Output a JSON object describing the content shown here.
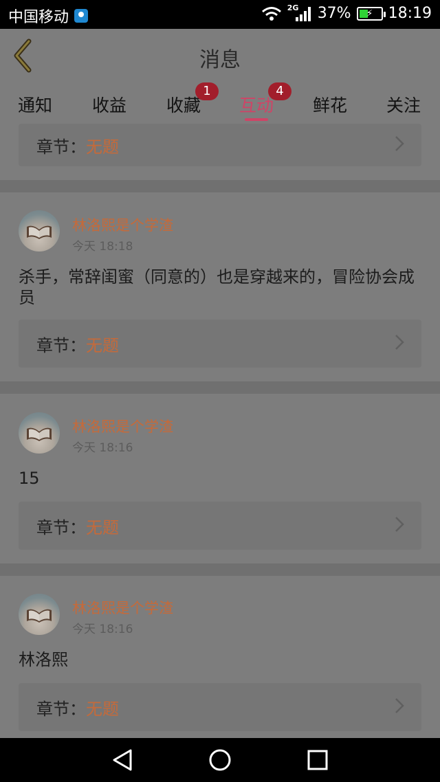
{
  "status_bar": {
    "carrier": "中国移动",
    "network": "2G",
    "battery": "37%",
    "time": "18:19",
    "battery_level": 0.37,
    "battery_color": "#2fd135"
  },
  "header": {
    "title": "消息",
    "back_icon": "back-chevron-icon"
  },
  "tabs": [
    {
      "label": "通知",
      "badge": ""
    },
    {
      "label": "收益",
      "badge": ""
    },
    {
      "label": "收藏",
      "badge": "1"
    },
    {
      "label": "互动",
      "badge": "4",
      "active": true
    },
    {
      "label": "鲜花",
      "badge": ""
    },
    {
      "label": "关注",
      "badge": ""
    }
  ],
  "accent_color": "#cf4466",
  "partial_item": {
    "chapter_label": "章节：",
    "chapter_value": "无题"
  },
  "messages": [
    {
      "user": "林洛熙是个学渣",
      "time": "今天 18:18",
      "text": "杀手，常辞闺蜜（同意的）也是穿越来的，冒险协会成员",
      "chapter_label": "章节：",
      "chapter_value": "无题"
    },
    {
      "user": "林洛熙是个学渣",
      "time": "今天 18:16",
      "text": "15",
      "chapter_label": "章节：",
      "chapter_value": "无题"
    },
    {
      "user": "林洛熙是个学渣",
      "time": "今天 18:16",
      "text": "林洛熙",
      "chapter_label": "章节：",
      "chapter_value": "无题"
    }
  ],
  "nav_bar": {
    "back": "triangle-back-icon",
    "home": "circle-home-icon",
    "recents": "square-recents-icon"
  }
}
